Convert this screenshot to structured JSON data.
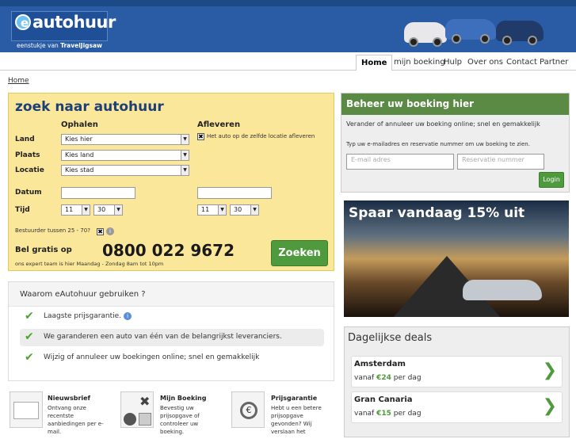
{
  "header": {
    "logo_e": "e",
    "logo_word": "autohuur",
    "tagline_prefix": "eenstukje van",
    "tagline_brand": "TravelJigsaw"
  },
  "nav": [
    "Home",
    "mijn boeking",
    "Hulp",
    "Over ons",
    "Contact",
    "Partner"
  ],
  "breadcrumb": "Home",
  "search": {
    "title": "zoek naar autohuur",
    "ophalen": "Ophalen",
    "afleveren": "Afleveren",
    "land_label": "Land",
    "plaats_label": "Plaats",
    "locatie_label": "Locatie",
    "datum_label": "Datum",
    "tijd_label": "Tijd",
    "land_value": "Kies hier",
    "plaats_value": "Kies land",
    "locatie_value": "Kies stad",
    "same_location_text": "Het auto op de zelfde locatie afleveren",
    "pick_hour": "11",
    "pick_min": "30",
    "drop_hour": "11",
    "drop_min": "30",
    "driver_age_text": "Bestuurder tussen 25 - 70?",
    "bel_gratis": "Bel gratis op",
    "phone": "0800 022 9672",
    "expert_text": "ons expert team is hier Maandag - Zondag 8am tot 10pm",
    "button": "Zoeken"
  },
  "why": {
    "title": "Waarom eAutohuur gebruiken ?",
    "items": [
      "Laagste prijsgarantie.",
      "We garanderen een auto van één van de belangrijkst leveranciers.",
      "Wijzig of annuleer uw boekingen online; snel en gemakkelijk"
    ]
  },
  "features": [
    {
      "title": "Nieuwsbrief",
      "text": "Ontvang onze recentste aanbiedingen per e-mail."
    },
    {
      "title": "Mijn Boeking",
      "text": "Bevestig uw prijsopgave of controleer uw boeking."
    },
    {
      "title": "Prijsgarantie",
      "text": "Hebt u een betere prijsopgave gevonden? Wij verslaan het"
    }
  ],
  "beheer": {
    "title": "Beheer uw boeking hier",
    "text1": "Verander of annuleer uw boeking online; snel en gemakkelijk",
    "text2": "Typ uw e-mailadres en reservatie nummer om uw boeking te zien.",
    "email_placeholder": "E-mail adres",
    "res_placeholder": "Reservatie nummer",
    "login": "Login"
  },
  "promo": "Spaar vandaag 15% uit",
  "deals": {
    "title": "Dagelijkse deals",
    "items": [
      {
        "city": "Amsterdam",
        "vanaf": "vanaf",
        "price": "€24",
        "per": "per dag"
      },
      {
        "city": "Gran Canaria",
        "vanaf": "vanaf",
        "price": "€15",
        "per": "per dag"
      }
    ]
  },
  "colors": {
    "brand_blue": "#2a5ca6",
    "accent_green": "#4e9a3c",
    "search_bg": "#fbe79a"
  }
}
